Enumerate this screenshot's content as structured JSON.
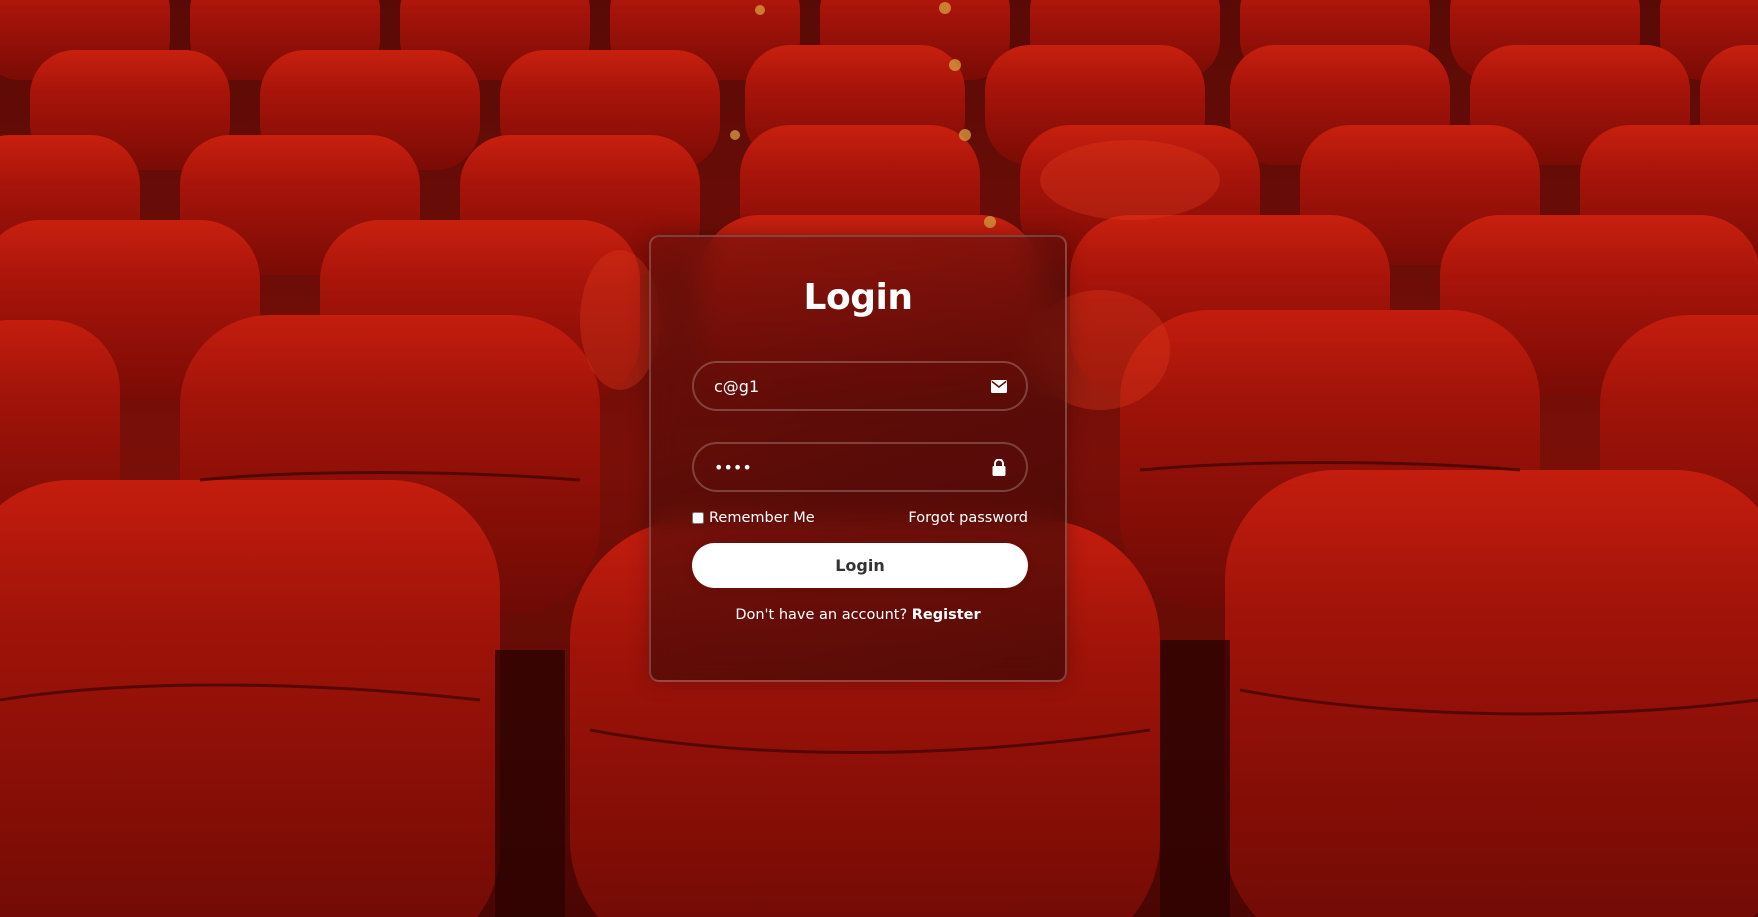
{
  "login": {
    "title": "Login",
    "email": {
      "value": "c@g1",
      "icon": "envelope-icon"
    },
    "password": {
      "value": "abcd",
      "icon": "lock-icon"
    },
    "remember_label": "Remember Me",
    "remember_checked": false,
    "forgot_label": "Forgot password",
    "submit_label": "Login",
    "register_prompt": "Don't have an account?",
    "register_label": "Register"
  },
  "background": {
    "description_icon": "theater-seats-image",
    "seat_color": "#b8170d",
    "shadow_color": "#3a0503"
  }
}
